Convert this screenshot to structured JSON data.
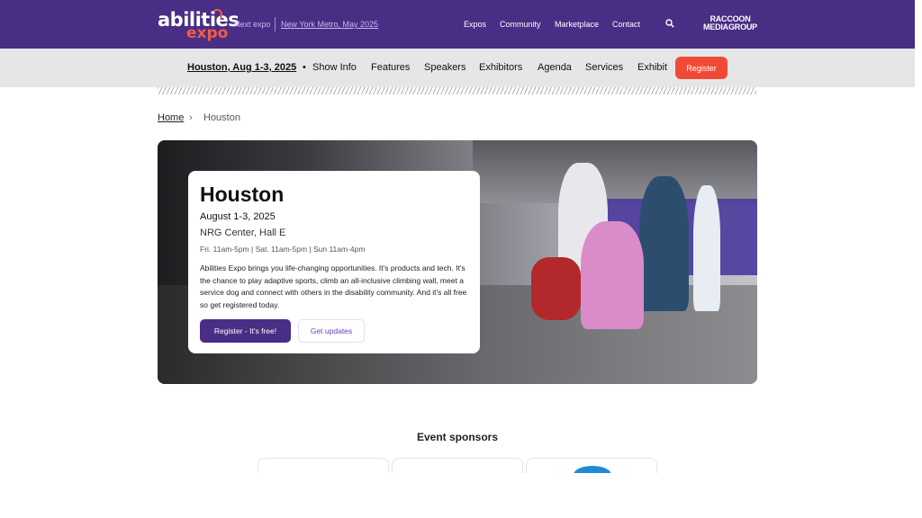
{
  "header": {
    "logo": {
      "word1": "abilities",
      "word2": "expo"
    },
    "next_expo_label": "Next expo",
    "next_expo_link": "New York Metro, May 2025",
    "nav": [
      "Expos",
      "Community",
      "Marketplace",
      "Contact"
    ],
    "partner": {
      "line1": "RACCOON",
      "line2": "MEDIAGROUP"
    },
    "colors": {
      "brand": "#4a2d85",
      "accent": "#f04a36"
    }
  },
  "subnav": {
    "event": "Houston, Aug 1-3, 2025",
    "separator": "•",
    "items": [
      "Show Info",
      "Features",
      "Speakers",
      "Exhibitors",
      "Agenda",
      "Services",
      "Exhibit"
    ],
    "register": "Register"
  },
  "breadcrumb": {
    "home": "Home",
    "separator": "›",
    "current": "Houston"
  },
  "hero": {
    "title": "Houston",
    "date": "August 1-3, 2025",
    "venue": "NRG Center, Hall E",
    "hours": "Fri. 11am-5pm | Sat. 11am-5pm | Sun 11am-4pm",
    "description": "Abilities Expo brings you life-changing opportunities. It's products and tech. It's the chance to play adaptive sports, climb an all-inclusive climbing wall, meet a service dog and connect with others in the disability community. And it's all free so get registered today.",
    "primary_button": "Register - It's free!",
    "secondary_button": "Get updates"
  },
  "sponsors": {
    "title": "Event sponsors"
  }
}
